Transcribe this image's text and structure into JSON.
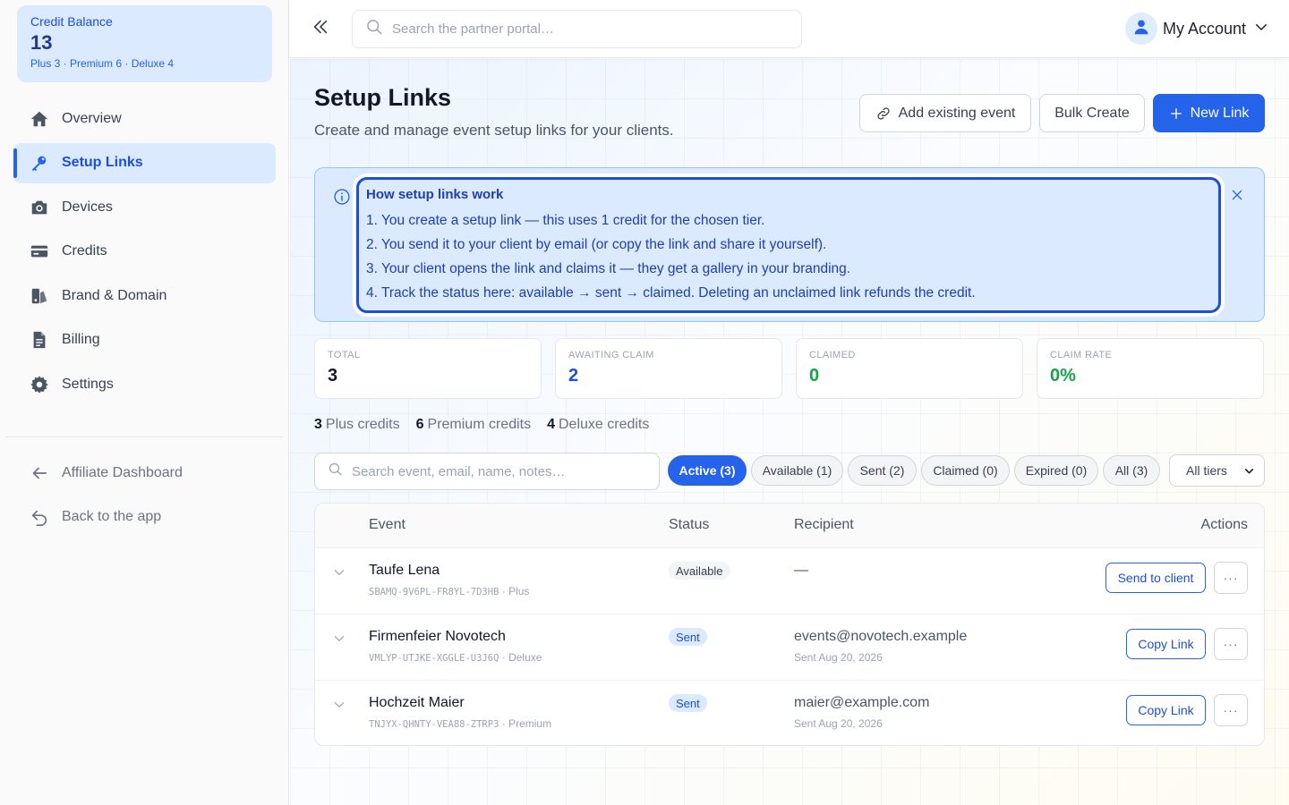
{
  "sidebar": {
    "credit_balance": {
      "label": "Credit Balance",
      "value": "13",
      "breakdown": "Plus 3 · Premium 6 · Deluxe 4"
    },
    "nav": [
      {
        "label": "Overview",
        "icon": "home-icon",
        "active": false
      },
      {
        "label": "Setup Links",
        "icon": "key-icon",
        "active": true
      },
      {
        "label": "Devices",
        "icon": "camera-icon",
        "active": false
      },
      {
        "label": "Credits",
        "icon": "credit-card-icon",
        "active": false
      },
      {
        "label": "Brand & Domain",
        "icon": "brand-icon",
        "active": false
      },
      {
        "label": "Billing",
        "icon": "invoice-icon",
        "active": false
      },
      {
        "label": "Settings",
        "icon": "gear-icon",
        "active": false
      }
    ],
    "secondary_nav": [
      {
        "label": "Affiliate Dashboard",
        "icon": "arrow-left-icon"
      },
      {
        "label": "Back to the app",
        "icon": "undo-arrow-icon"
      }
    ]
  },
  "topbar": {
    "search_placeholder": "Search the partner portal…",
    "account_label": "My Account"
  },
  "page": {
    "title": "Setup Links",
    "subtitle": "Create and manage event setup links for your clients.",
    "buttons": {
      "add_existing": "Add existing event",
      "bulk_create": "Bulk Create",
      "new_link": "New Link"
    }
  },
  "info": {
    "title": "How setup links work",
    "lines": [
      "1. You create a setup link — this uses 1 credit for the chosen tier.",
      "2. You send it to your client by email (or copy the link and share it yourself).",
      "3. Your client opens the link and claims it — they get a gallery in your branding.",
      "4. Track the status here: available → sent → claimed. Deleting an unclaimed link refunds the credit."
    ]
  },
  "stats": [
    {
      "label": "TOTAL",
      "value": "3",
      "color": "#111827"
    },
    {
      "label": "AWAITING CLAIM",
      "value": "2",
      "color": "#1d4ed8"
    },
    {
      "label": "CLAIMED",
      "value": "0",
      "color": "#16a34a"
    },
    {
      "label": "CLAIM RATE",
      "value": "0%",
      "color": "#16a34a"
    }
  ],
  "credits": [
    {
      "count": "3",
      "label": "Plus credits"
    },
    {
      "count": "6",
      "label": "Premium credits"
    },
    {
      "count": "4",
      "label": "Deluxe credits"
    }
  ],
  "filters": {
    "search_placeholder": "Search event, email, name, notes…",
    "chips": [
      "Active (3)",
      "Available (1)",
      "Sent (2)",
      "Claimed (0)",
      "Expired (0)",
      "All (3)"
    ],
    "active_chip": 0,
    "tier_select": "All tiers"
  },
  "table": {
    "headers": {
      "event": "Event",
      "status": "Status",
      "recipient": "Recipient",
      "actions": "Actions"
    },
    "rows": [
      {
        "event": "Taufe Lena",
        "code": "SBAMQ-9V6PL-FR8YL-7D3HB",
        "tier": "Plus",
        "status": "Available",
        "status_kind": "available",
        "recipient": "—",
        "sent": "",
        "action": "Send to client"
      },
      {
        "event": "Firmenfeier Novotech",
        "code": "VMLYP-UTJKE-XGGLE-U3J6Q",
        "tier": "Deluxe",
        "status": "Sent",
        "status_kind": "sent",
        "recipient": "events@novotech.example",
        "sent": "Sent Aug 20, 2026",
        "action": "Copy Link"
      },
      {
        "event": "Hochzeit Maier",
        "code": "TNJYX-QHNTY-VEA88-ZTRP3",
        "tier": "Premium",
        "status": "Sent",
        "status_kind": "sent",
        "recipient": "maier@example.com",
        "sent": "Sent Aug 20, 2026",
        "action": "Copy Link"
      }
    ],
    "more_label": "···"
  },
  "colors": {
    "accent": "#2563eb",
    "accent_light": "#dbeafe",
    "claimed": "#16a34a"
  }
}
